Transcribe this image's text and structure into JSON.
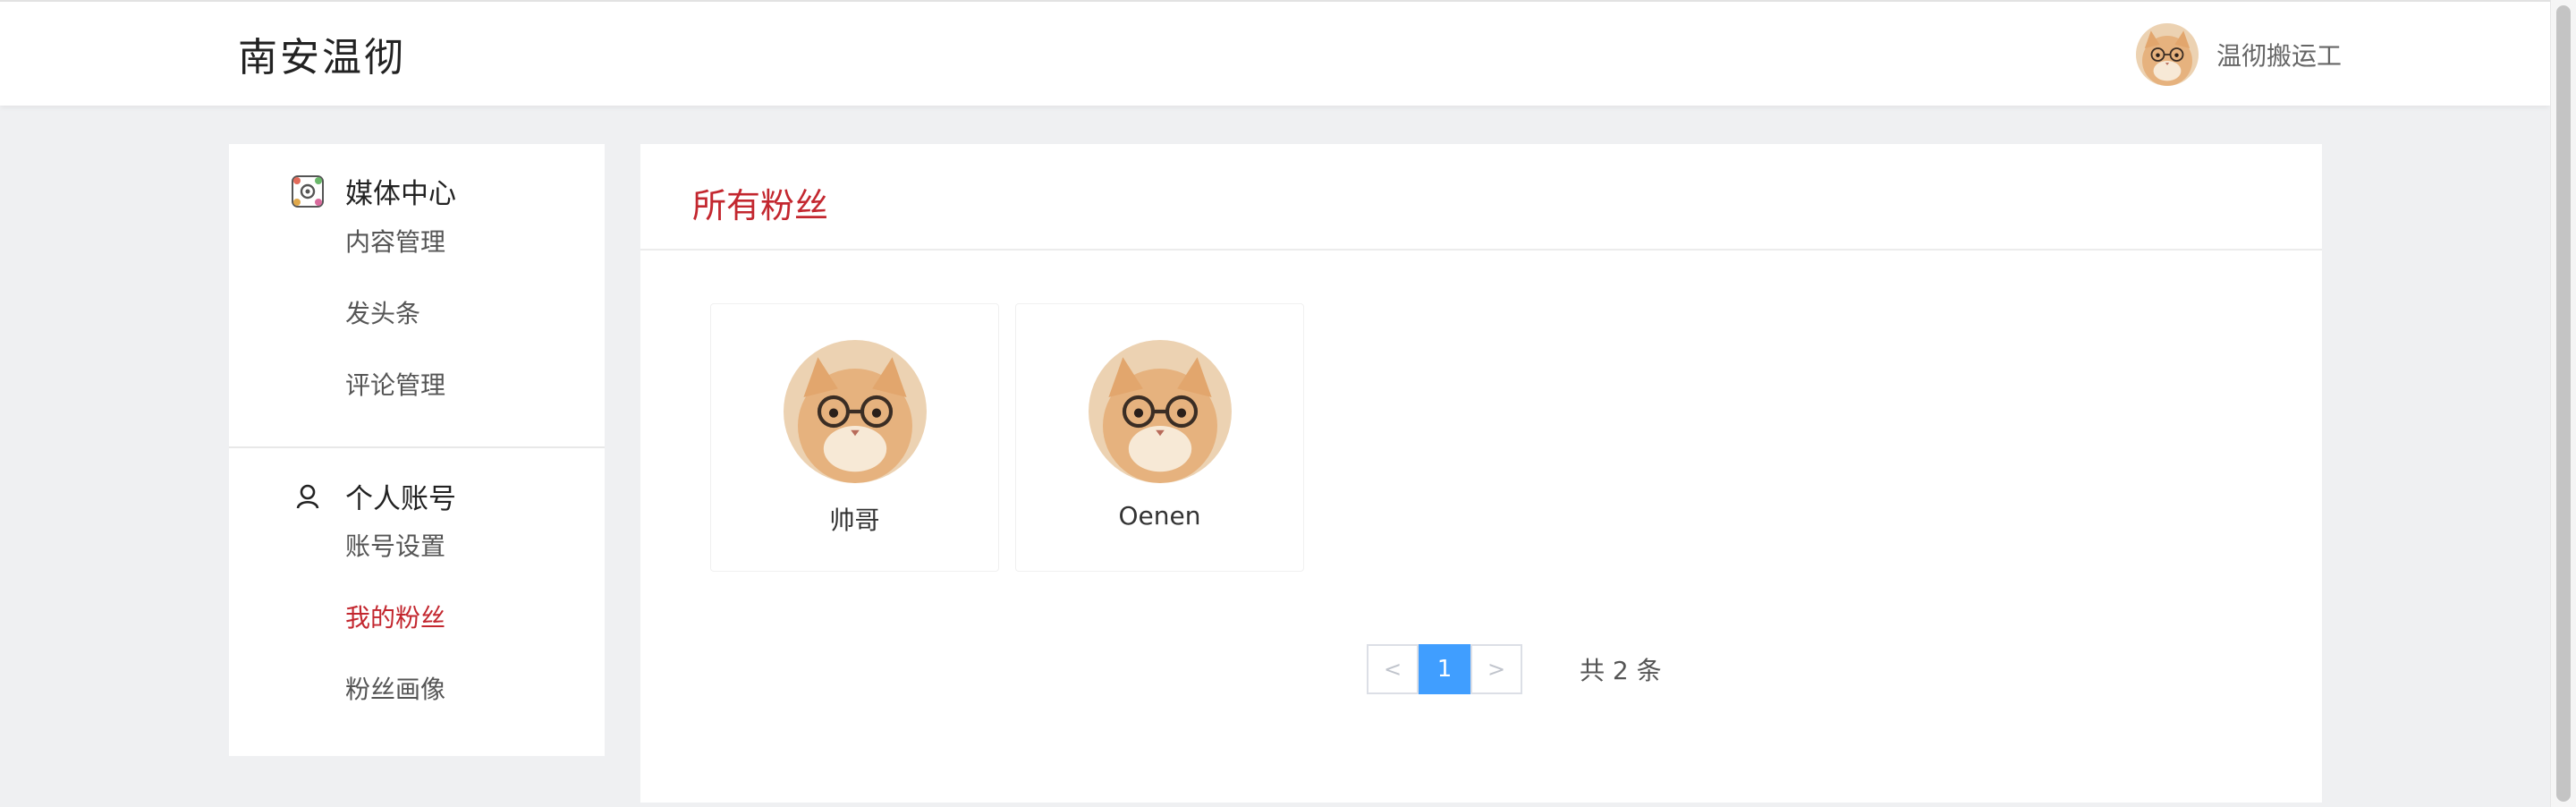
{
  "header": {
    "logo_text": "南安温彻",
    "username": "温彻搬运工"
  },
  "sidebar": {
    "groups": [
      {
        "title": "媒体中心",
        "icon": "media-center-icon",
        "items": [
          "内容管理",
          "发头条",
          "评论管理"
        ]
      },
      {
        "title": "个人账号",
        "icon": "user-account-icon",
        "items": [
          "账号设置",
          "我的粉丝",
          "粉丝画像"
        ]
      }
    ],
    "active_item": "我的粉丝"
  },
  "main": {
    "title": "所有粉丝",
    "fans": [
      {
        "name": "帅哥",
        "avatar": "cat-with-glasses-avatar"
      },
      {
        "name": "Oenen",
        "avatar": "cat-with-glasses-avatar"
      }
    ],
    "pagination": {
      "prev": "<",
      "current_page": "1",
      "next": ">",
      "total_text": "共 2 条"
    }
  },
  "colors": {
    "accent": "#c3272f",
    "page_active": "#409eff",
    "background": "#eff0f2"
  }
}
